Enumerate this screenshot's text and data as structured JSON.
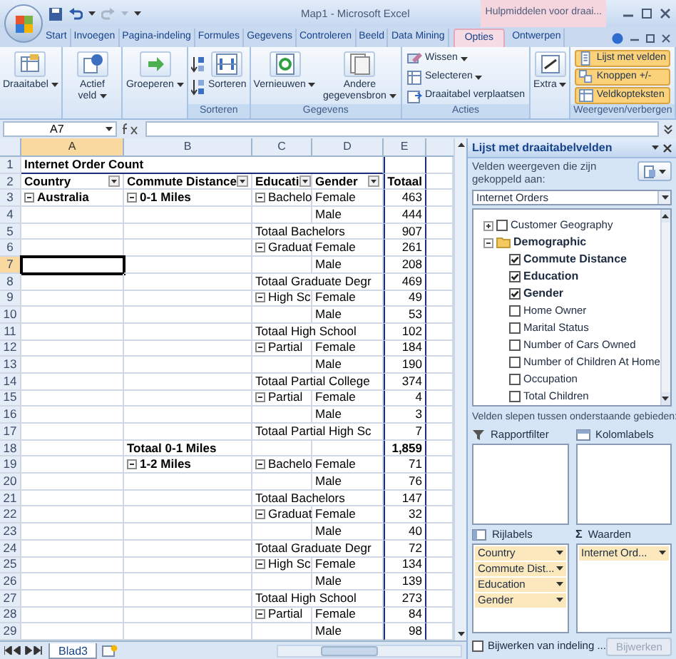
{
  "title_bar": {
    "title": "Map1 - Microsoft Excel",
    "context_tab": "Hulpmiddelen voor draai..."
  },
  "tabs": [
    {
      "label": "Start",
      "selected": false
    },
    {
      "label": "Invoegen",
      "selected": false
    },
    {
      "label": "Pagina-indeling",
      "selected": false
    },
    {
      "label": "Formules",
      "selected": false
    },
    {
      "label": "Gegevens",
      "selected": false
    },
    {
      "label": "Controleren",
      "selected": false
    },
    {
      "label": "Beeld",
      "selected": false
    },
    {
      "label": "Data Mining",
      "selected": false
    },
    {
      "label": "Opties",
      "selected": true
    },
    {
      "label": "Ontwerpen",
      "selected": false
    }
  ],
  "ribbon": [
    {
      "kind": "large",
      "buttons": [
        {
          "label": "Draaitabel",
          "dropdown": true
        }
      ]
    },
    {
      "kind": "large",
      "buttons": [
        {
          "label": "Actief veld",
          "dropdown": true
        }
      ]
    },
    {
      "kind": "large",
      "buttons": [
        {
          "label": "Groeperen",
          "dropdown": true
        }
      ]
    },
    {
      "kind": "sort",
      "label": "Sorteren",
      "buttons": [
        {
          "label": "Sorteren",
          "dropdown": false
        }
      ]
    },
    {
      "kind": "large",
      "label": "Gegevens",
      "buttons": [
        {
          "label": "Vernieuwen",
          "dropdown": true
        },
        {
          "label": "Andere gegevensbron",
          "dropdown": true
        }
      ]
    },
    {
      "kind": "small",
      "label": "Acties",
      "buttons": [
        {
          "label": "Wissen",
          "dropdown": true
        },
        {
          "label": "Selecteren",
          "dropdown": true
        },
        {
          "label": "Draaitabel verplaatsen",
          "dropdown": false
        }
      ]
    },
    {
      "kind": "large",
      "buttons": [
        {
          "label": "Extra",
          "dropdown": true
        }
      ]
    },
    {
      "kind": "toggles",
      "label": "Weergeven/verbergen",
      "buttons": [
        {
          "label": "Lijst met velden",
          "on": true
        },
        {
          "label": "Knoppen +/-",
          "on": true
        },
        {
          "label": "Veldkopteksten",
          "on": true
        }
      ]
    }
  ],
  "formula_bar": {
    "name_box": "A7"
  },
  "columns": [
    {
      "label": "A",
      "selected": true
    },
    {
      "label": "B",
      "selected": false
    },
    {
      "label": "C",
      "selected": false
    },
    {
      "label": "D",
      "selected": false
    },
    {
      "label": "E",
      "selected": false
    }
  ],
  "rows": [
    {
      "number": "1",
      "kind": "title",
      "selected": false,
      "label": "Internet Order Count"
    },
    {
      "number": "2",
      "kind": "header",
      "selected": false,
      "country": "Country",
      "distance": "Commute Distance",
      "education": "Educati",
      "gender": "Gender",
      "count": "Totaal"
    },
    {
      "number": "3",
      "kind": "detail",
      "selected": false,
      "country": "Australia",
      "distance": "0-1 Miles",
      "education": "Bachelo",
      "gender": "Female",
      "count": "463"
    },
    {
      "number": "4",
      "kind": "detail",
      "selected": false,
      "gender": "Male",
      "count": "444"
    },
    {
      "number": "5",
      "kind": "subtotal",
      "selected": false,
      "label": "Totaal Bachelors",
      "count": "907"
    },
    {
      "number": "6",
      "kind": "detail",
      "selected": false,
      "education": "Graduat",
      "gender": "Female",
      "count": "261"
    },
    {
      "number": "7",
      "kind": "detail",
      "selected": true,
      "gender": "Male",
      "count": "208"
    },
    {
      "number": "8",
      "kind": "subtotal",
      "selected": false,
      "label": "Totaal Graduate Degr",
      "count": "469"
    },
    {
      "number": "9",
      "kind": "detail",
      "selected": false,
      "education": "High Sc",
      "gender": "Female",
      "count": "49"
    },
    {
      "number": "10",
      "kind": "detail",
      "selected": false,
      "gender": "Male",
      "count": "53"
    },
    {
      "number": "11",
      "kind": "subtotal",
      "selected": false,
      "label": "Totaal High School",
      "count": "102"
    },
    {
      "number": "12",
      "kind": "detail",
      "selected": false,
      "education": "Partial",
      "gender": "Female",
      "count": "184"
    },
    {
      "number": "13",
      "kind": "detail",
      "selected": false,
      "gender": "Male",
      "count": "190"
    },
    {
      "number": "14",
      "kind": "subtotal",
      "selected": false,
      "label": "Totaal Partial College",
      "count": "374"
    },
    {
      "number": "15",
      "kind": "detail",
      "selected": false,
      "education": "Partial",
      "gender": "Female",
      "count": "4"
    },
    {
      "number": "16",
      "kind": "detail",
      "selected": false,
      "gender": "Male",
      "count": "3"
    },
    {
      "number": "17",
      "kind": "subtotal",
      "selected": false,
      "label": "Totaal Partial High Sc",
      "count": "7"
    },
    {
      "number": "18",
      "kind": "total",
      "selected": false,
      "label": "Totaal 0-1 Miles",
      "count": "1,859"
    },
    {
      "number": "19",
      "kind": "detail",
      "selected": false,
      "distance": "1-2 Miles",
      "education": "Bachelo",
      "gender": "Female",
      "count": "71"
    },
    {
      "number": "20",
      "kind": "detail",
      "selected": false,
      "gender": "Male",
      "count": "76"
    },
    {
      "number": "21",
      "kind": "subtotal",
      "selected": false,
      "label": "Totaal Bachelors",
      "count": "147"
    },
    {
      "number": "22",
      "kind": "detail",
      "selected": false,
      "education": "Graduat",
      "gender": "Female",
      "count": "32"
    },
    {
      "number": "23",
      "kind": "detail",
      "selected": false,
      "gender": "Male",
      "count": "40"
    },
    {
      "number": "24",
      "kind": "subtotal",
      "selected": false,
      "label": "Totaal Graduate Degr",
      "count": "72"
    },
    {
      "number": "25",
      "kind": "detail",
      "selected": false,
      "education": "High Sc",
      "gender": "Female",
      "count": "134"
    },
    {
      "number": "26",
      "kind": "detail",
      "selected": false,
      "gender": "Male",
      "count": "139"
    },
    {
      "number": "27",
      "kind": "subtotal",
      "selected": false,
      "label": "Totaal High School",
      "count": "273"
    },
    {
      "number": "28",
      "kind": "detail",
      "selected": false,
      "education": "Partial",
      "gender": "Female",
      "count": "84"
    },
    {
      "number": "29",
      "kind": "detail",
      "selected": false,
      "gender": "Male",
      "count": "98"
    }
  ],
  "sheet_tabs": [
    {
      "label": "Blad3",
      "selected": true
    }
  ],
  "field_list": {
    "title": "Lijst met draaitabelvelden",
    "source_label": "Velden weergeven die zijn gekoppeld aan:",
    "source": "Internet Orders",
    "fields": [
      {
        "kind": "dimension",
        "label": "Customer Geography",
        "expanded": false,
        "checked": false
      },
      {
        "kind": "folder",
        "label": "Demographic",
        "expanded": true,
        "children": [
          {
            "label": "Commute Distance",
            "checked": true
          },
          {
            "label": "Education",
            "checked": true
          },
          {
            "label": "Gender",
            "checked": true
          },
          {
            "label": "Home Owner",
            "checked": false
          },
          {
            "label": "Marital Status",
            "checked": false
          },
          {
            "label": "Number of Cars Owned",
            "checked": false
          },
          {
            "label": "Number of Children At Home",
            "checked": false
          },
          {
            "label": "Occupation",
            "checked": false
          },
          {
            "label": "Total Children",
            "checked": false
          }
        ]
      }
    ],
    "areas_label": "Velden slepen tussen onderstaande gebieden:",
    "areas": [
      {
        "kind": "filter",
        "label": "Rapportfilter"
      },
      {
        "kind": "columns",
        "label": "Kolomlabels"
      },
      {
        "kind": "rows",
        "label": "Rijlabels",
        "items": [
          "Country",
          "Commute Dist...",
          "Education",
          "Gender"
        ]
      },
      {
        "kind": "values",
        "label": "Waarden",
        "icon": "Σ",
        "items": [
          "Internet Ord..."
        ]
      }
    ],
    "defer": {
      "label": "Bijwerken van indeling ...",
      "checked": false
    },
    "update_button": {
      "label": "Bijwerken",
      "disabled": true
    }
  }
}
